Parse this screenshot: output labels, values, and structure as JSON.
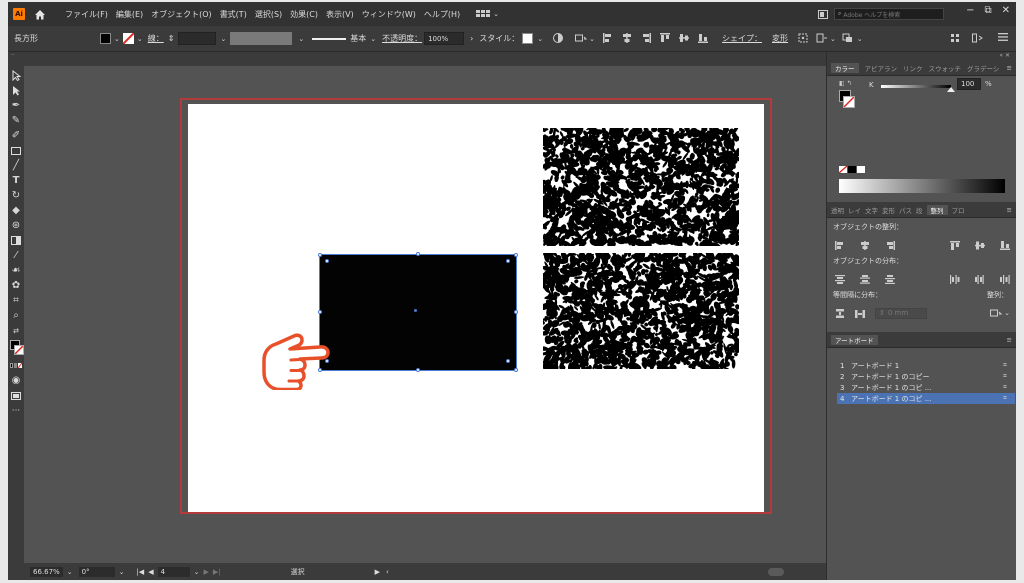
{
  "app": {
    "logo": "Ai",
    "menus": [
      "ファイル(F)",
      "編集(E)",
      "オブジェクト(O)",
      "書式(T)",
      "選択(S)",
      "効果(C)",
      "表示(V)",
      "ウィンドウ(W)",
      "ヘルプ(H)"
    ],
    "search_placeholder": "Adobe ヘルプを検索",
    "window_controls": [
      "−",
      "⧉",
      "✕"
    ]
  },
  "control_bar": {
    "object_type": "長方形",
    "stroke_label": "線：",
    "stroke_style": "基本",
    "opacity_label": "不透明度：",
    "opacity_value": "100%",
    "style_label": "スタイル：",
    "shape_label": "シェイプ：",
    "transform_label": "変形",
    "colors": {
      "fill": "#000000",
      "stroke": "#ffffff"
    }
  },
  "status_bar": {
    "zoom": "66.67%",
    "rotation": "0°",
    "artboard_index": "4",
    "tool": "選択"
  },
  "color_panel": {
    "tabs": [
      "カラー",
      "アピアラン",
      "リンク",
      "スウォッチ",
      "グラデーシ"
    ],
    "channel": "K",
    "value": "100",
    "unit": "%",
    "level": 1.0
  },
  "align_panel": {
    "tabs": [
      "透明",
      "レイ",
      "文字",
      "変形",
      "パス",
      "段",
      "整列",
      "プロ"
    ],
    "align_objects": "オブジェクトの整列：",
    "distribute_objects": "オブジェクトの分布：",
    "distribute_spacing": "等間隔に分布：",
    "align_to": "整列：",
    "spacing_value": "0 mm"
  },
  "artboards_panel": {
    "title": "アートボード",
    "items": [
      {
        "num": "1",
        "name": "アートボード 1",
        "selected": false
      },
      {
        "num": "2",
        "name": "アートボード 1 のコピー",
        "selected": false
      },
      {
        "num": "3",
        "name": "アートボード 1 のコピ ...",
        "selected": false
      },
      {
        "num": "4",
        "name": "アートボード 1 のコピ ...",
        "selected": true
      }
    ]
  },
  "accent": {
    "artboard_border": "#b4393b",
    "selection": "#4a7bd6",
    "hand": "#e8502a",
    "list_select": "#4b73b3"
  }
}
